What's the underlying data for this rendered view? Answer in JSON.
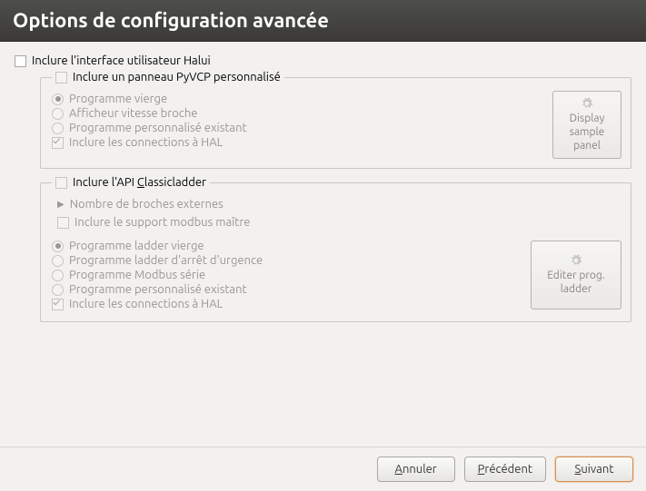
{
  "title": "Options de configuration avancée",
  "halui": {
    "include_label": "Inclure l'interface utilisateur Halui"
  },
  "pyvcp": {
    "legend": "Inclure un panneau PyVCP personnalisé",
    "opt_blank": "Programme vierge",
    "opt_spindle": "Afficheur vitesse broche",
    "opt_custom": "Programme personnalisé existant",
    "opt_hal": "Inclure les connections à HAL",
    "btn_l1": "Display",
    "btn_l2": "sample",
    "btn_l3": "panel"
  },
  "ladder": {
    "legend_prefix": "Inclure l'API ",
    "legend_mnemonic": "C",
    "legend_suffix": "lassicladder",
    "exp_spindles": "Nombre de broches externes",
    "modbus_master": "Inclure le support modbus maître",
    "opt_blank": "Programme ladder vierge",
    "opt_estop": "Programme ladder d'arrêt d'urgence",
    "opt_modbus": "Programme Modbus série",
    "opt_custom": "Programme personnalisé existant",
    "opt_hal": "Inclure les connections à HAL",
    "btn_l1": "Editer prog.",
    "btn_l2": "ladder"
  },
  "buttons": {
    "cancel_pre": "A",
    "cancel_rest": "nnuler",
    "back_pre": "P",
    "back_rest": "récédent",
    "next_pre": "S",
    "next_rest": "uivant"
  }
}
